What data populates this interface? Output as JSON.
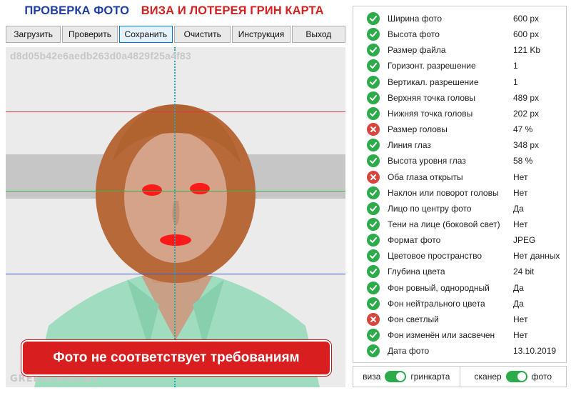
{
  "header": {
    "title_left": "ПРОВЕРКА ФОТО",
    "title_right": "ВИЗА И ЛОТЕРЕЯ ГРИН КАРТА"
  },
  "toolbar": [
    {
      "label": "Загрузить",
      "active": false
    },
    {
      "label": "Проверить",
      "active": false
    },
    {
      "label": "Сохранить",
      "active": true
    },
    {
      "label": "Очистить",
      "active": false
    },
    {
      "label": "Инструкция",
      "active": false
    },
    {
      "label": "Выход",
      "active": false
    }
  ],
  "photo": {
    "hash": "d8d05b42e6aedb263d0a4829f25a4f83",
    "watermark": "GREENCARD.BY",
    "banner": "Фото не соответствует требованиям"
  },
  "checks": [
    {
      "label": "Ширина фото",
      "value": "600 px",
      "status": "ok"
    },
    {
      "label": "Высота фото",
      "value": "600 px",
      "status": "ok"
    },
    {
      "label": "Размер файла",
      "value": "121 Kb",
      "status": "ok"
    },
    {
      "label": "Горизонт. разрешение",
      "value": "1",
      "status": "ok"
    },
    {
      "label": "Вертикал. разрешение",
      "value": "1",
      "status": "ok"
    },
    {
      "label": "Верхняя точка головы",
      "value": "489 px",
      "status": "ok"
    },
    {
      "label": "Нижняя точка головы",
      "value": "202 px",
      "status": "ok"
    },
    {
      "label": "Размер головы",
      "value": "47 %",
      "status": "bad"
    },
    {
      "label": "Линия глаз",
      "value": "348 px",
      "status": "ok"
    },
    {
      "label": "Высота уровня глаз",
      "value": "58 %",
      "status": "ok"
    },
    {
      "label": "Оба глаза открыты",
      "value": "Нет",
      "status": "bad"
    },
    {
      "label": "Наклон или поворот головы",
      "value": "Нет",
      "status": "ok"
    },
    {
      "label": "Лицо по центру фото",
      "value": "Да",
      "status": "ok"
    },
    {
      "label": "Тени на лице (боковой свет)",
      "value": "Нет",
      "status": "ok"
    },
    {
      "label": "Формат фото",
      "value": "JPEG",
      "status": "ok"
    },
    {
      "label": "Цветовое пространство",
      "value": "Нет данных",
      "status": "ok"
    },
    {
      "label": "Глубина цвета",
      "value": "24 bit",
      "status": "ok"
    },
    {
      "label": "Фон ровный, однородный",
      "value": "Да",
      "status": "ok"
    },
    {
      "label": "Фон нейтрального цвета",
      "value": "Да",
      "status": "ok"
    },
    {
      "label": "Фон светлый",
      "value": "Нет",
      "status": "bad"
    },
    {
      "label": "Фон изменён или засвечен",
      "value": "Нет",
      "status": "ok"
    },
    {
      "label": "Дата фото",
      "value": "13.10.2019",
      "status": "ok"
    }
  ],
  "toggles": [
    {
      "left": "виза",
      "right": "гринкарта",
      "on": true
    },
    {
      "left": "сканер",
      "right": "фото",
      "on": true
    }
  ],
  "colors": {
    "ok": "#2daa4a",
    "bad": "#d9443c",
    "banner": "#d81e1e",
    "title_blue": "#1f3fa6",
    "title_red": "#d42121"
  }
}
